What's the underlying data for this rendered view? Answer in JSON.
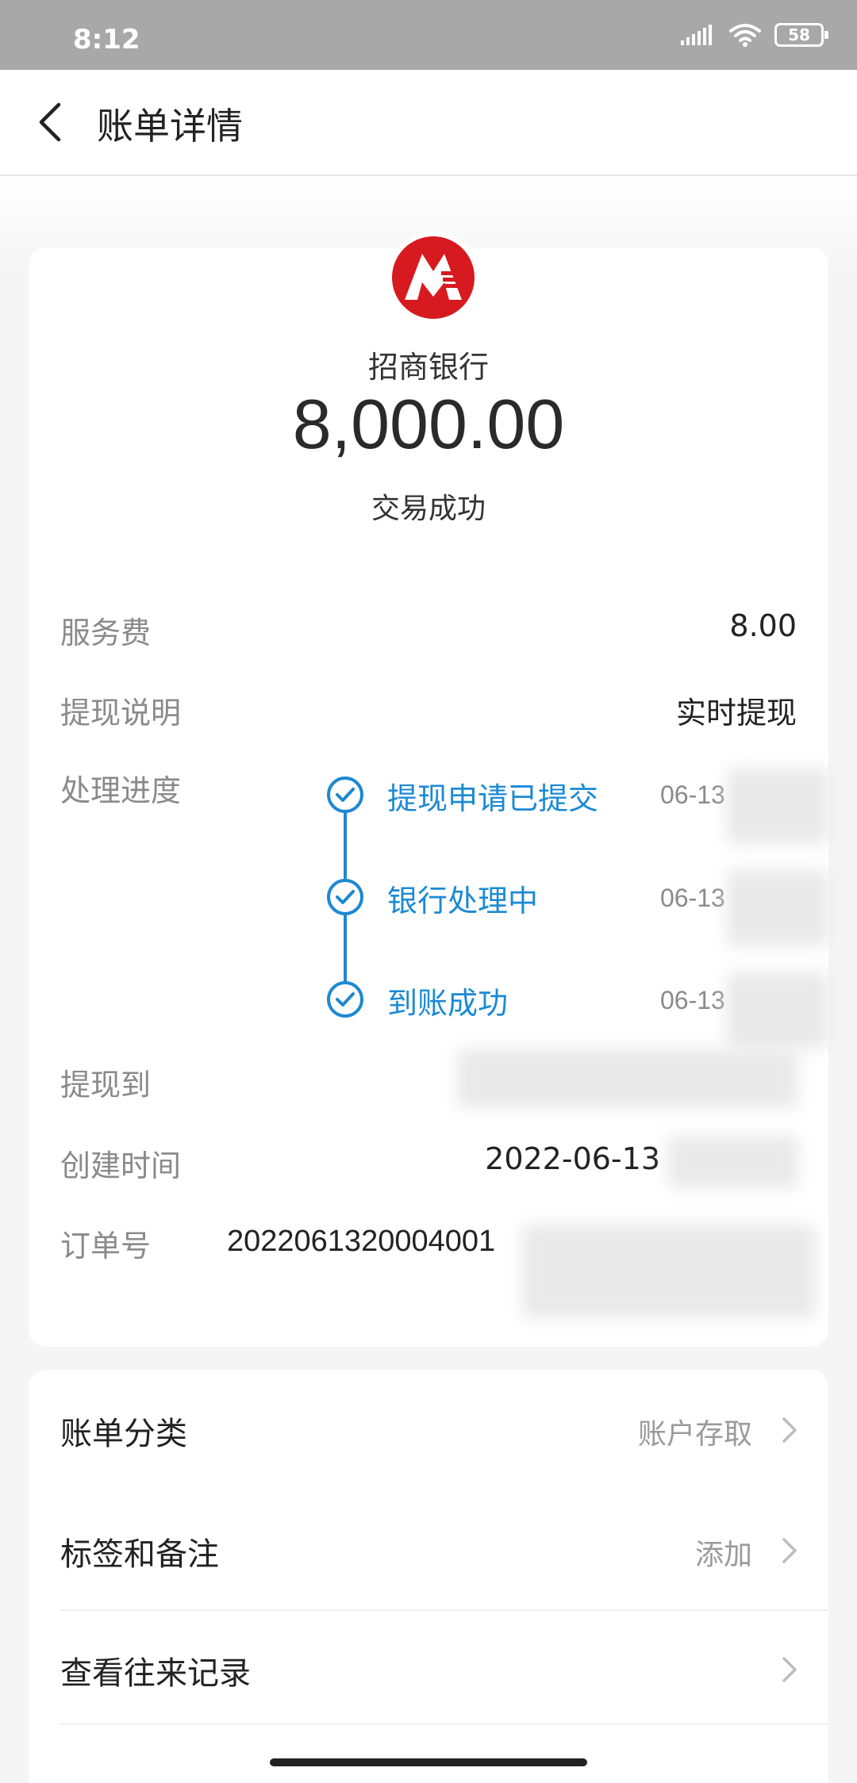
{
  "status_bar": {
    "time": "8:12",
    "battery": "58"
  },
  "nav": {
    "title": "账单详情"
  },
  "summary": {
    "bank_name": "招商银行",
    "amount": "8,000.00",
    "status": "交易成功"
  },
  "details": {
    "service_fee_label": "服务费",
    "service_fee_value": "8.00",
    "withdraw_desc_label": "提现说明",
    "withdraw_desc_value": "实时提现",
    "progress_label": "处理进度",
    "steps": [
      {
        "label": "提现申请已提交",
        "time": "06-13"
      },
      {
        "label": "银行处理中",
        "time": "06-13"
      },
      {
        "label": "到账成功",
        "time": "06-13"
      }
    ],
    "withdraw_to_label": "提现到",
    "created_label": "创建时间",
    "created_value": "2022-06-13",
    "order_label": "订单号",
    "order_value": "2022061320004001"
  },
  "menu": [
    {
      "label": "账单分类",
      "value": "账户存取"
    },
    {
      "label": "标签和备注",
      "value": "添加"
    },
    {
      "label": "查看往来记录",
      "value": ""
    }
  ],
  "colors": {
    "accent": "#1a8ad4",
    "logo_red": "#d71920"
  }
}
